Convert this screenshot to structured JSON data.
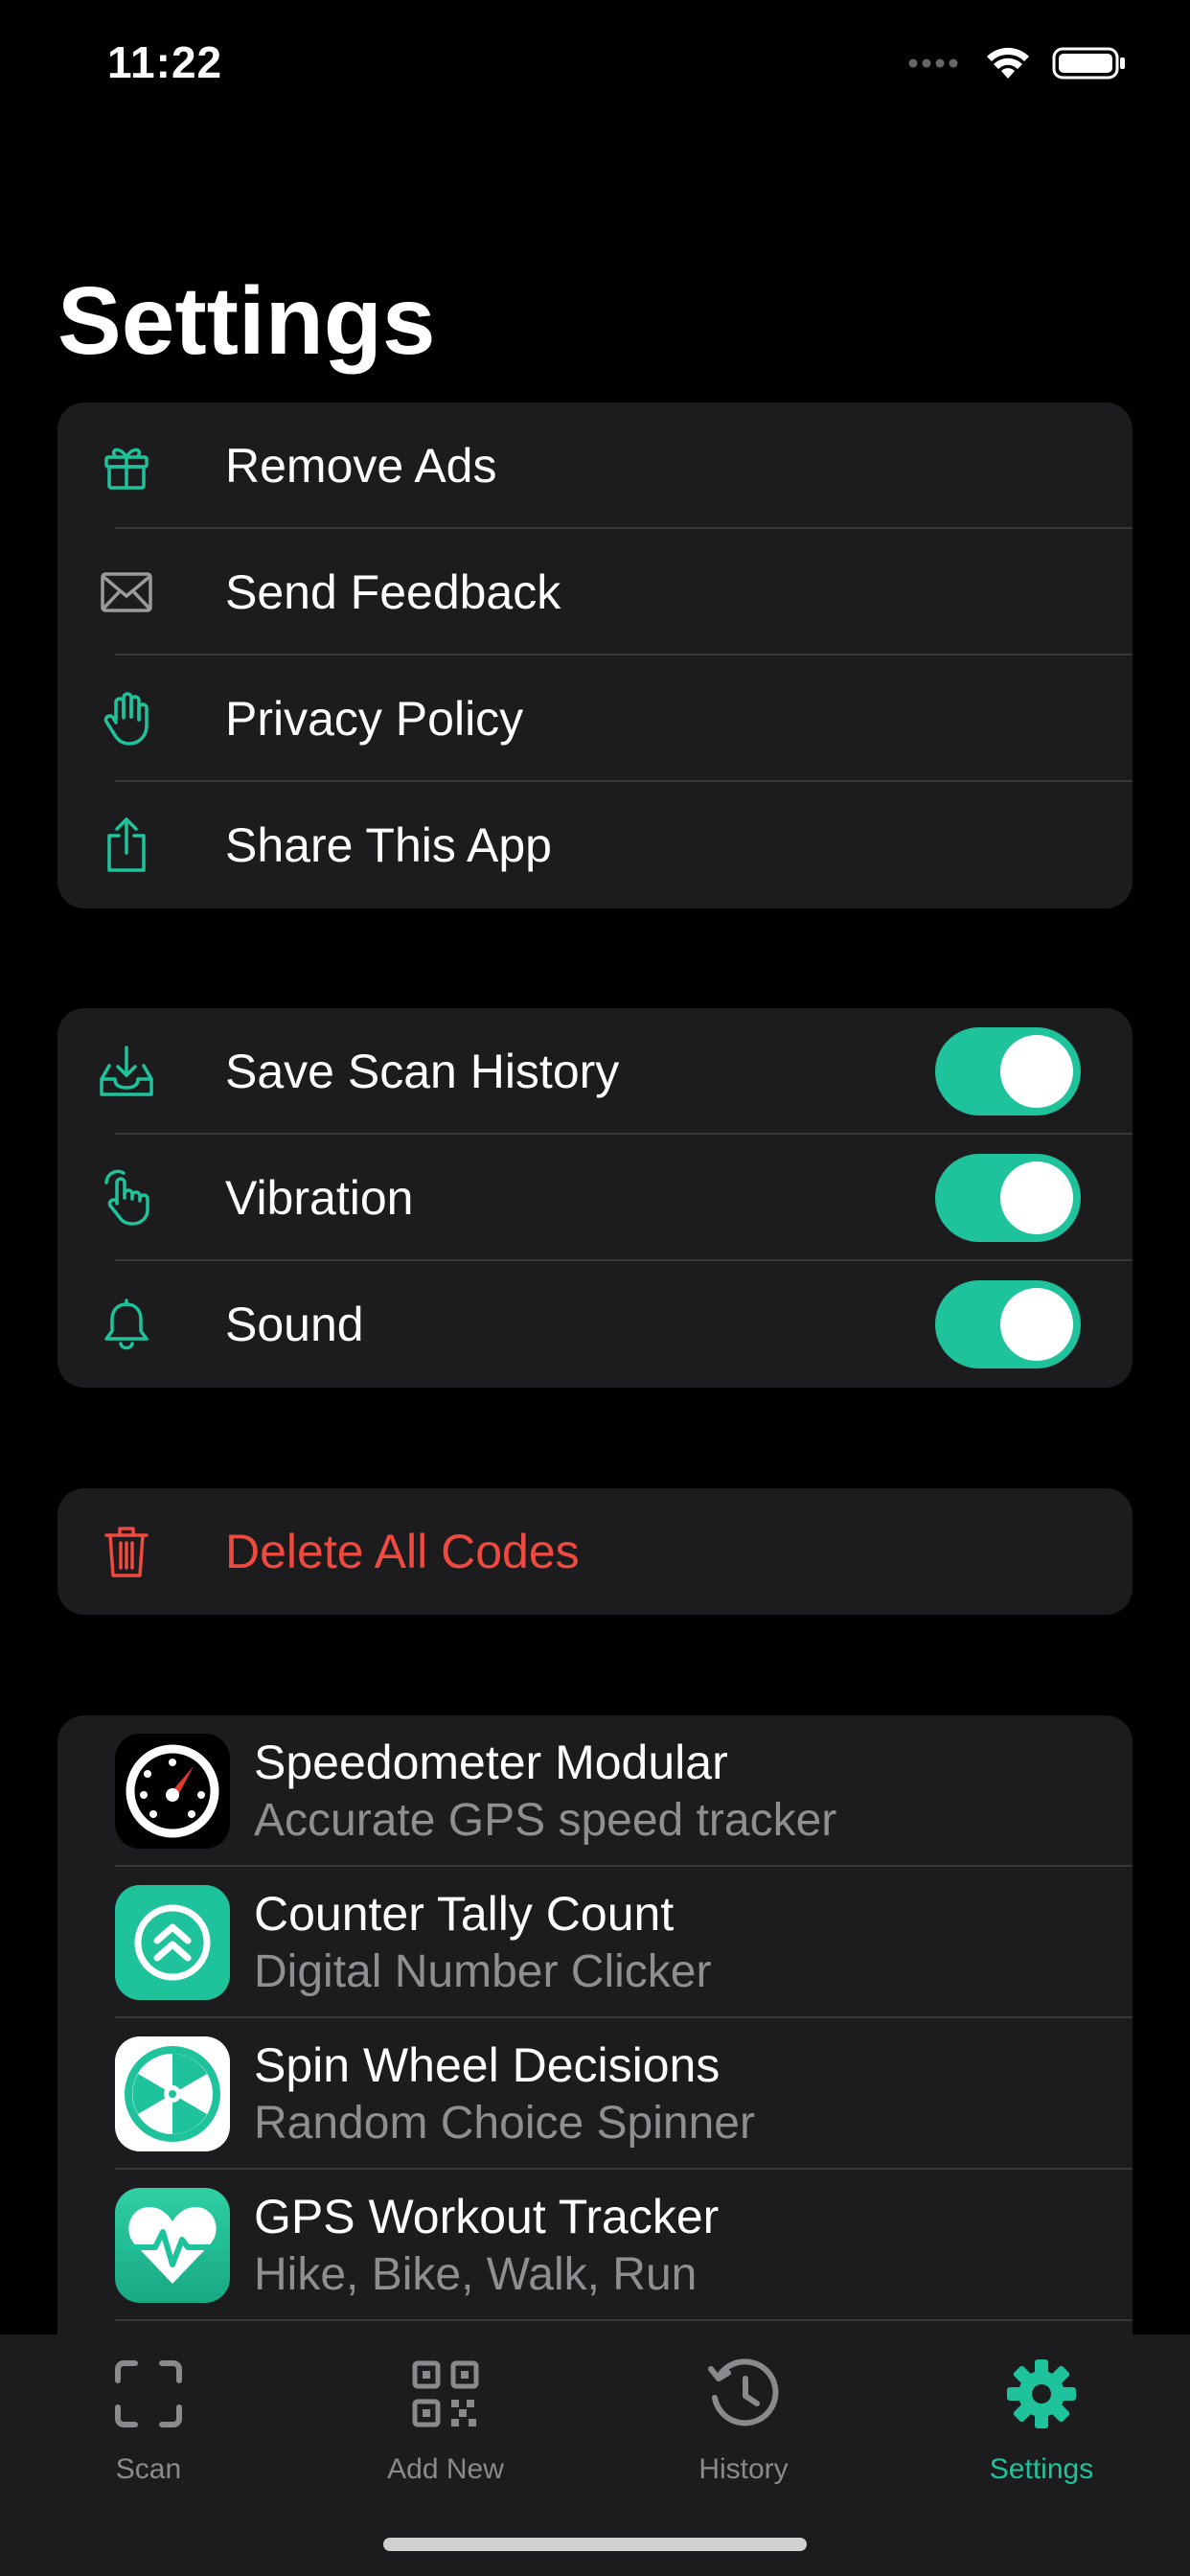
{
  "status": {
    "time": "11:22"
  },
  "page_title": "Settings",
  "colors": {
    "accent": "#1fc39b",
    "destructive": "#ef4a3f",
    "card": "#1c1c1e",
    "separator": "#38383a"
  },
  "group1": {
    "remove_ads": "Remove Ads",
    "send_feedback": "Send Feedback",
    "privacy_policy": "Privacy Policy",
    "share_app": "Share This App"
  },
  "group2": {
    "save_history": "Save Scan History",
    "vibration": "Vibration",
    "sound": "Sound"
  },
  "toggles": {
    "save_history_on": true,
    "vibration_on": true,
    "sound_on": true
  },
  "delete_all": "Delete All Codes",
  "apps": [
    {
      "name": "Speedometer Modular",
      "subtitle": "Accurate GPS speed tracker",
      "icon": "speedometer-icon"
    },
    {
      "name": "Counter Tally Count",
      "subtitle": "Digital Number Clicker",
      "icon": "chevrons-up-icon"
    },
    {
      "name": "Spin Wheel Decisions",
      "subtitle": "Random Choice Spinner",
      "icon": "spin-wheel-icon"
    },
    {
      "name": "GPS Workout Tracker",
      "subtitle": "Hike, Bike, Walk, Run",
      "icon": "heart-pulse-icon"
    }
  ],
  "tabs": [
    {
      "label": "Scan",
      "icon": "scan-frame-icon",
      "active": false
    },
    {
      "label": "Add New",
      "icon": "qr-code-icon",
      "active": false
    },
    {
      "label": "History",
      "icon": "history-icon",
      "active": false
    },
    {
      "label": "Settings",
      "icon": "gear-icon",
      "active": true
    }
  ]
}
